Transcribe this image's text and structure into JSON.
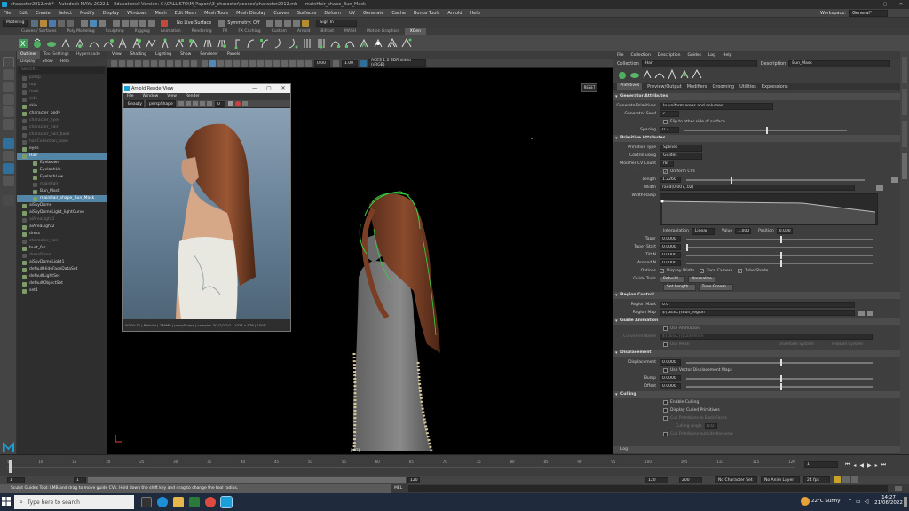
{
  "window": {
    "title": "character2012.mb* - Autodesk MAYA 2022.1 - Educational Version: C:\\CALLISTO\\M_Papers\\3_character\\scenes\\character2012.mb  ---  mainHair_shape_Bun_Mask",
    "controls": [
      "—",
      "▢",
      "✕"
    ]
  },
  "menubar": {
    "items": [
      "File",
      "Edit",
      "Create",
      "Select",
      "Modify",
      "Display",
      "Windows",
      "Mesh",
      "Edit Mesh",
      "Mesh Tools",
      "Mesh Display",
      "Curves",
      "Surfaces",
      "Deform",
      "UV",
      "Generate",
      "Cache",
      "Bonus Tools",
      "Arnold",
      "Help"
    ],
    "workspace_label": "Workspace:",
    "workspace_value": "General*"
  },
  "statusline": {
    "mode": "Modeling",
    "live_surface": "No Live Surface",
    "symmetry": "Symmetry: Off",
    "sign_in": "Sign In"
  },
  "shelf": {
    "tabs": [
      "Curves / Surfaces",
      "Poly Modeling",
      "Sculpting",
      "Rigging",
      "Animation",
      "Rendering",
      "FX",
      "FX Caching",
      "Custom",
      "Arnold",
      "Bifrost",
      "MASH",
      "Motion Graphics",
      "XGen"
    ],
    "active_tab": "XGen"
  },
  "outliner": {
    "tabs": [
      "Outliner",
      "Tool Settings",
      "Hypershade"
    ],
    "menus": [
      "Display",
      "Show",
      "Help"
    ],
    "search_placeholder": "Search...",
    "items": [
      {
        "label": "persp",
        "dim": true
      },
      {
        "label": "top",
        "dim": true
      },
      {
        "label": "front",
        "dim": true
      },
      {
        "label": "side",
        "dim": true
      },
      {
        "label": "skin",
        "dim": false
      },
      {
        "label": "character_body",
        "dim": false
      },
      {
        "label": "character_eyes",
        "dim": true
      },
      {
        "label": "character_hair",
        "dim": true
      },
      {
        "label": "character_hair_base",
        "dim": true
      },
      {
        "label": "hairCollection_base",
        "dim": true
      },
      {
        "label": "eyes",
        "dim": false
      },
      {
        "label": "Hair",
        "dim": false,
        "sel": true
      },
      {
        "label": "Eyebrows",
        "dim": false
      },
      {
        "label": "EyelashUp",
        "dim": false
      },
      {
        "label": "EyelashLow",
        "dim": false
      },
      {
        "label": "mainHair",
        "dim": true
      },
      {
        "label": "Bun_Mask",
        "dim": false
      },
      {
        "label": "mainHair_shape_Bun_Mask",
        "dim": false,
        "sel": true
      },
      {
        "label": "aiSkyDome",
        "dim": false
      },
      {
        "label": "aiSkyDomeLight_lightCurve",
        "dim": false
      },
      {
        "label": "aiAreaLight1",
        "dim": true
      },
      {
        "label": "aiAreaLight2",
        "dim": false
      },
      {
        "label": "dress",
        "dim": false
      },
      {
        "label": "character_hair",
        "dim": true
      },
      {
        "label": "bust_fur",
        "dim": false
      },
      {
        "label": "dressPlane",
        "dim": true
      },
      {
        "label": "aiSkyDomeLight1",
        "dim": false
      },
      {
        "label": "defaultHideFaceDataSet",
        "dim": false
      },
      {
        "label": "defaultLightSet",
        "dim": false
      },
      {
        "label": "defaultObjectSet",
        "dim": false
      },
      {
        "label": "set1",
        "dim": false
      }
    ]
  },
  "viewport": {
    "menus": [
      "View",
      "Shading",
      "Lighting",
      "Show",
      "Renderer",
      "Panels"
    ],
    "field_a": "0.00",
    "field_b": "1.00",
    "color_space": "ACES 1.0 SDR-video (sRGB)",
    "camera_label": "persp",
    "reset_label": "RESET"
  },
  "render_view": {
    "title": "Arnold RenderView",
    "menus": [
      "File",
      "Window",
      "View",
      "Render"
    ],
    "beauty": "Beauty",
    "camera": "perspShape",
    "exposure": "0",
    "status": "00:00:12 | Rebuild | 786Mb | perspShape | samples 3/3/2/2/2/2 | 1024 x 576 | 100%"
  },
  "attribute_editor": {
    "menus": [
      "File",
      "Collection",
      "Description",
      "Guides",
      "Log",
      "Help"
    ],
    "collection_label": "Collection",
    "collection_value": "Hair",
    "description_label": "Description",
    "description_value": "Bun_Mask",
    "tabs": [
      "Primitives",
      "Preview/Output",
      "Modifiers",
      "Grooming",
      "Utilities",
      "Expressions"
    ],
    "active_tab": "Primitives",
    "sections": {
      "generator": "Generator Attributes",
      "primitive": "Primitive Attributes",
      "region": "Region Control",
      "guide_anim": "Guide Animation",
      "displacement": "Displacement",
      "culling": "Culling"
    },
    "generate_primitives_label": "Generate Primitives",
    "generate_primitives_value": "In uniform areas and volumes",
    "generator_seed_label": "Generator Seed",
    "generator_seed_value": "2",
    "flip_label": "Flip to other side of surface",
    "spacing_label": "Spacing",
    "spacing_value": "0.2",
    "primitive_type_label": "Primitive Type",
    "primitive_type_value": "Splines",
    "control_using_label": "Control using",
    "control_using_value": "Guides",
    "modifier_cv_label": "Modifier CV Count",
    "modifier_cv_value": "78",
    "uniform_cvs_label": "Uniform CVs",
    "length_label": "Length",
    "length_value": "1.2260",
    "width_label": "Width",
    "width_value": "rand(0.007,.02)",
    "width_ramp_label": "Width Ramp",
    "interpolation_label": "Interpolation",
    "interpolation_value": "Linear",
    "value_label": "Value",
    "value_value": "1.000",
    "position_label": "Position",
    "position_value": "0.000",
    "taper_label": "Taper",
    "taper_value": "0.0000",
    "taper_start_label": "Taper Start",
    "taper_start_value": "0.0000",
    "tilt_n_label": "Tilt N",
    "tilt_n_value": "0.0000",
    "around_n_label": "Around N",
    "around_n_value": "0.0000",
    "options_label": "Options",
    "opt1": "Display Width",
    "opt2": "Face Camera",
    "opt3": "Tube Shade",
    "guide_tools_label": "Guide Tools",
    "rebuild": "Rebuild...",
    "normalize": "Normalize",
    "set_length": "Set Length...",
    "tube_groom": "Tube Groom...",
    "region_mask_label": "Region Mask",
    "region_mask_value": "0.0",
    "region_map_label": "Region Map",
    "region_map_value": "${DESC}/Bun_region",
    "use_animation_label": "Use Animation",
    "curve_file_label": "Curve File Name",
    "curve_file_value": "${DESC}/guideAnim",
    "use_mesh_label": "Use Mesh",
    "undeform_label": "Undeform System",
    "rebuild_label": "Rebuild System",
    "displacement_label": "Displacement",
    "displacement_value": "0.0000",
    "use_vector_label": "Use Vector Displacement Maps",
    "bump_label": "Bump",
    "bump_value": "0.0000",
    "offset_label": "Offset",
    "offset_value": "0.0000",
    "enable_culling": "Enable Culling",
    "display_culled": "Display Culled Primitives",
    "cull_flag": "Cull Primitives in Back Faces",
    "culling_angle_label": "Culling Angle",
    "culling_angle_value": "0.0",
    "cull_outside": "Cull Primitives outside the view",
    "log_label": "Log"
  },
  "timeline": {
    "ticks": [
      "5",
      "10",
      "15",
      "20",
      "25",
      "30",
      "35",
      "40",
      "45",
      "50",
      "55",
      "60",
      "65",
      "70",
      "75",
      "80",
      "85",
      "90",
      "95",
      "100",
      "105",
      "110",
      "115",
      "120"
    ],
    "current_frame": "1",
    "range_start": "1",
    "range_start2": "1",
    "range_end": "120",
    "range_end2": "120",
    "anim_end": "200",
    "character_set": "No Character Set",
    "anim_layer": "No Anim Layer",
    "fps": "24 fps"
  },
  "command": {
    "lang": "MEL",
    "help": "Sculpt Guides Tool: LMB and drag to move guide CVs. Hold down the shift key and drag to change the tool radius."
  },
  "taskbar": {
    "search_placeholder": "Type here to search",
    "weather": "22°C  Sunny",
    "time": "14:27",
    "date": "21/06/2022"
  }
}
